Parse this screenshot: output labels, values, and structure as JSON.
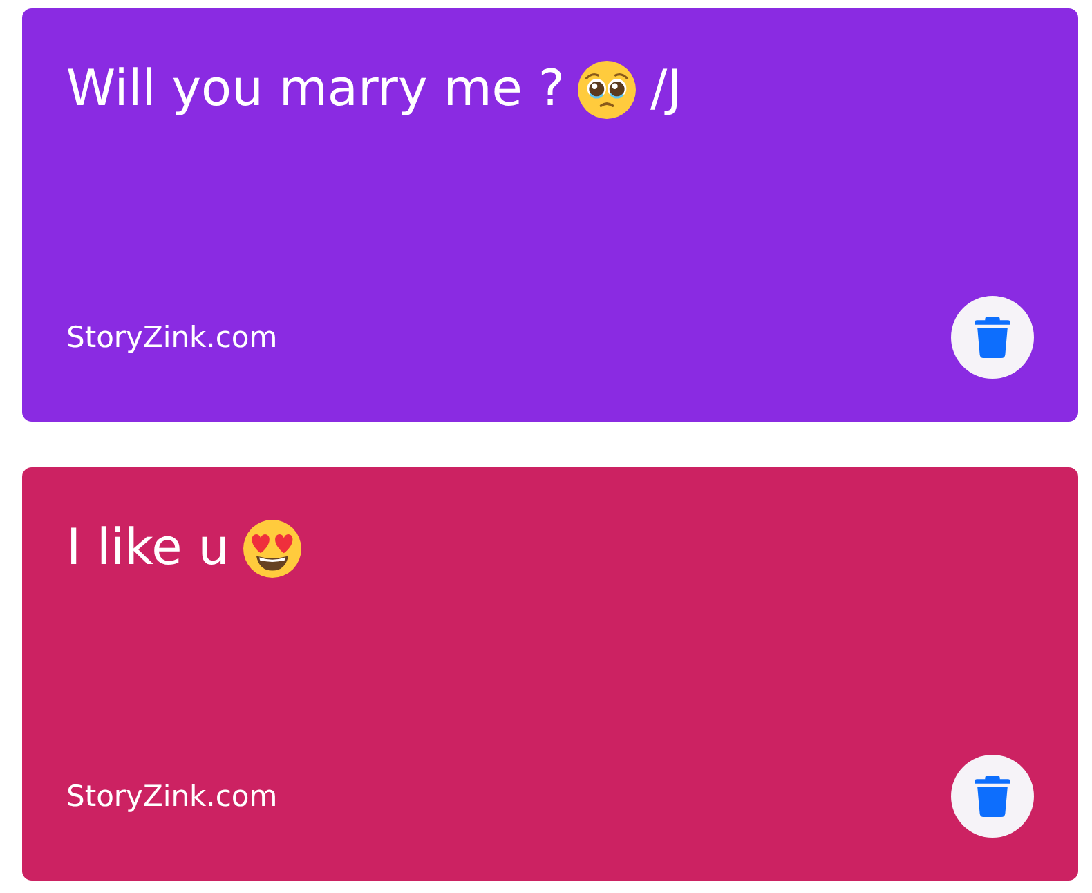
{
  "cards": [
    {
      "color": "#8a2be2",
      "message": [
        {
          "kind": "text",
          "text": "Will you marry me ?"
        },
        {
          "kind": "pleading"
        },
        {
          "kind": "text",
          "text": "/J"
        }
      ],
      "site": "StoryZink.com"
    },
    {
      "color": "#cc2262",
      "message": [
        {
          "kind": "text",
          "text": "I like u"
        },
        {
          "kind": "hearteyes"
        }
      ],
      "site": "StoryZink.com"
    }
  ]
}
